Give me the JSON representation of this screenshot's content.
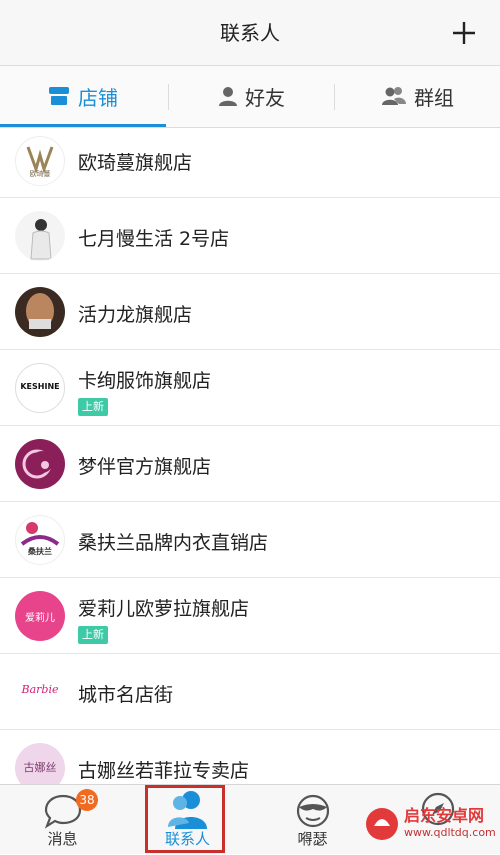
{
  "header": {
    "title": "联系人",
    "add_icon": "plus-icon"
  },
  "tabs": [
    {
      "label": "店铺",
      "icon": "store-icon",
      "active": true
    },
    {
      "label": "好友",
      "icon": "person-icon",
      "active": false
    },
    {
      "label": "群组",
      "icon": "group-icon",
      "active": false
    }
  ],
  "stores": [
    {
      "name": "欧琦蔓旗舰店",
      "badge": "",
      "avatar_text": "欧琦蔓"
    },
    {
      "name": "七月慢生活 2号店",
      "badge": ""
    },
    {
      "name": "活力龙旗舰店",
      "badge": ""
    },
    {
      "name": "卡绚服饰旗舰店",
      "badge": "上新",
      "avatar_text": "KESHINE"
    },
    {
      "name": "梦伴官方旗舰店",
      "badge": ""
    },
    {
      "name": "桑扶兰品牌内衣直销店",
      "badge": "",
      "avatar_text": "桑扶兰"
    },
    {
      "name": "爱莉儿欧萝拉旗舰店",
      "badge": "上新",
      "avatar_text": "爱莉儿"
    },
    {
      "name": "城市名店街",
      "badge": "",
      "avatar_text": "Barbie"
    },
    {
      "name": "古娜丝若菲拉专卖店",
      "badge": "",
      "avatar_text": "古娜丝"
    }
  ],
  "bottom_nav": [
    {
      "label": "消息",
      "icon": "chat-bubble-icon",
      "badge": "38",
      "active": false
    },
    {
      "label": "联系人",
      "icon": "contacts-icon",
      "active": true
    },
    {
      "label": "嘚瑟",
      "icon": "face-icon",
      "active": false
    },
    {
      "label": "",
      "icon": "compass-icon",
      "active": false
    }
  ],
  "watermark": {
    "text": "启东安卓网",
    "url": "www.qdltdq.com"
  }
}
